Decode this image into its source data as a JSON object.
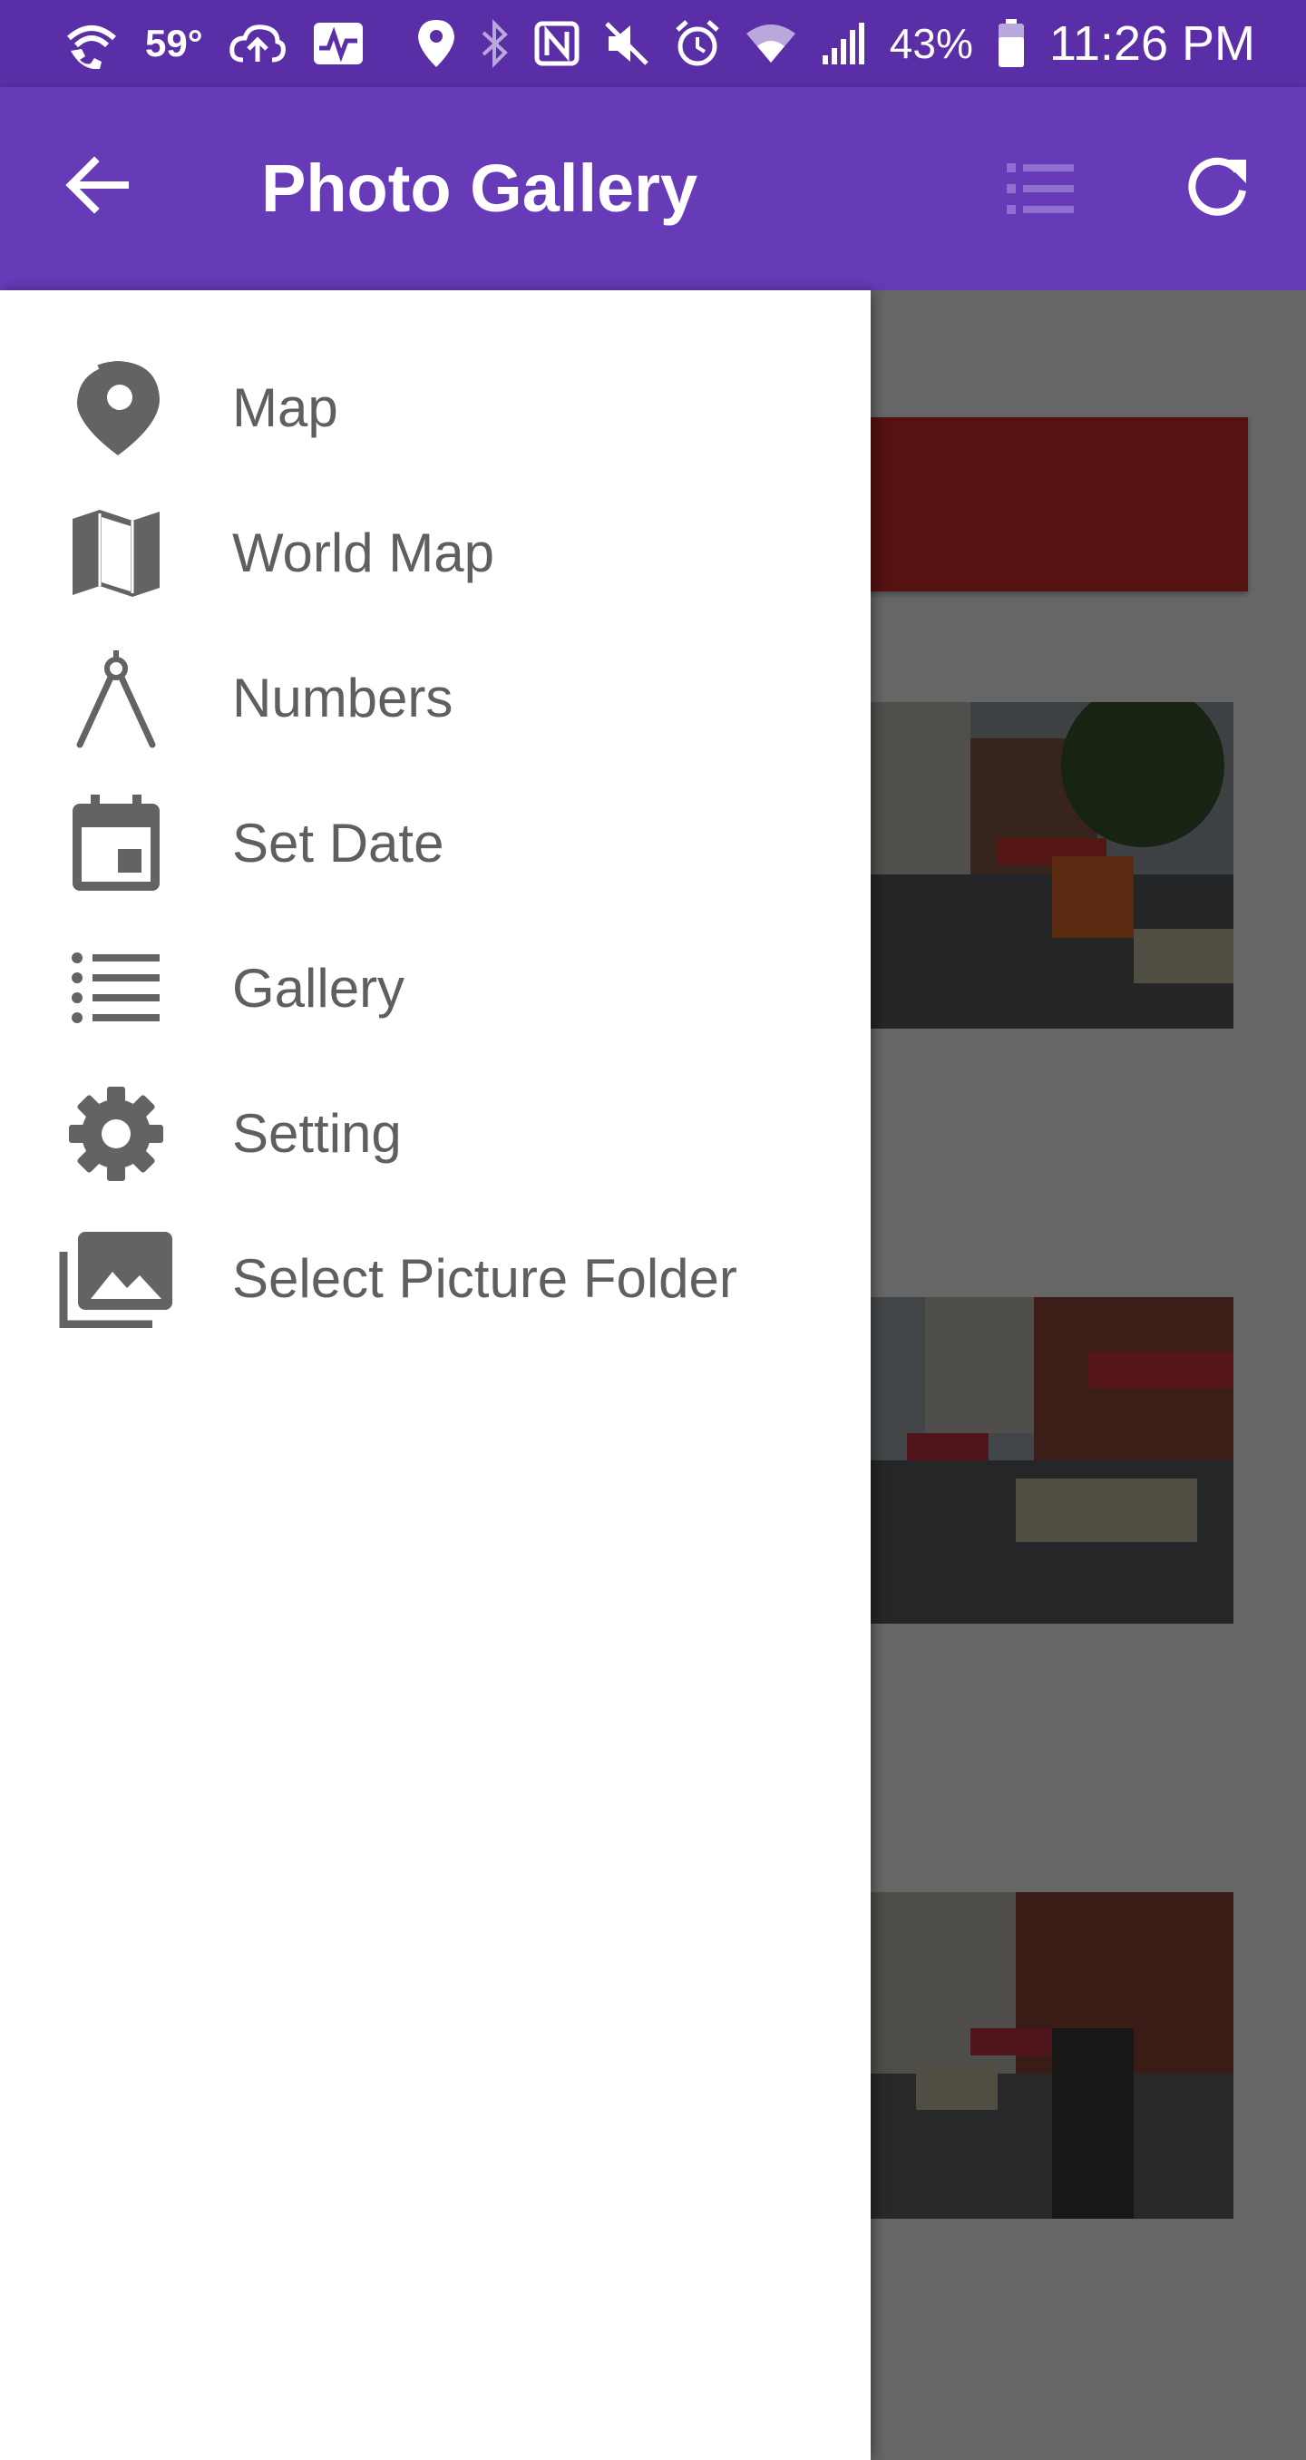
{
  "status_bar": {
    "temperature": "59°",
    "battery": "43%",
    "time": "11:26 PM",
    "icons": [
      "wifi-calling-icon",
      "cloud-upload-icon",
      "activity-icon",
      "location-icon",
      "bluetooth-icon",
      "nfc-icon",
      "mute-icon",
      "alarm-icon",
      "wifi-icon",
      "signal-icon",
      "battery-icon"
    ]
  },
  "app_bar": {
    "title": "Photo Gallery",
    "back_icon": "arrow-back-icon",
    "list_icon": "list-view-icon",
    "refresh_icon": "refresh-icon"
  },
  "colors": {
    "status_bar": "#5a2ea6",
    "app_bar": "#673ab7",
    "card": "#d62b2b",
    "drawer_text": "#5f5f5f",
    "drawer_icon": "#636363"
  },
  "drawer": {
    "items": [
      {
        "label": "Map",
        "icon": "map-pin-icon"
      },
      {
        "label": "World Map",
        "icon": "world-map-icon"
      },
      {
        "label": "Numbers",
        "icon": "compass-icon"
      },
      {
        "label": "Set Date",
        "icon": "calendar-icon"
      },
      {
        "label": "Gallery",
        "icon": "list-icon"
      },
      {
        "label": "Setting",
        "icon": "gear-icon"
      },
      {
        "label": "Select Picture Folder",
        "icon": "photo-library-icon"
      }
    ]
  }
}
